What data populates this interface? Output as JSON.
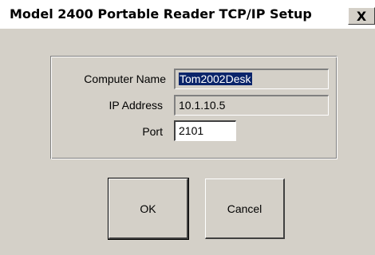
{
  "window": {
    "title": "Model 2400 Portable Reader TCP/IP Setup",
    "close_glyph": "X"
  },
  "form": {
    "computer_name_label": "Computer Name",
    "computer_name_value": "Tom2002Desk",
    "ip_address_label": "IP Address",
    "ip_address_value": "10.1.10.5",
    "port_label": "Port",
    "port_value": "2101"
  },
  "buttons": {
    "ok_label": "OK",
    "cancel_label": "Cancel"
  },
  "icons": {
    "close": "close-icon"
  },
  "colors": {
    "dialog_face": "#d4d0c8",
    "selection": "#0a246a"
  }
}
